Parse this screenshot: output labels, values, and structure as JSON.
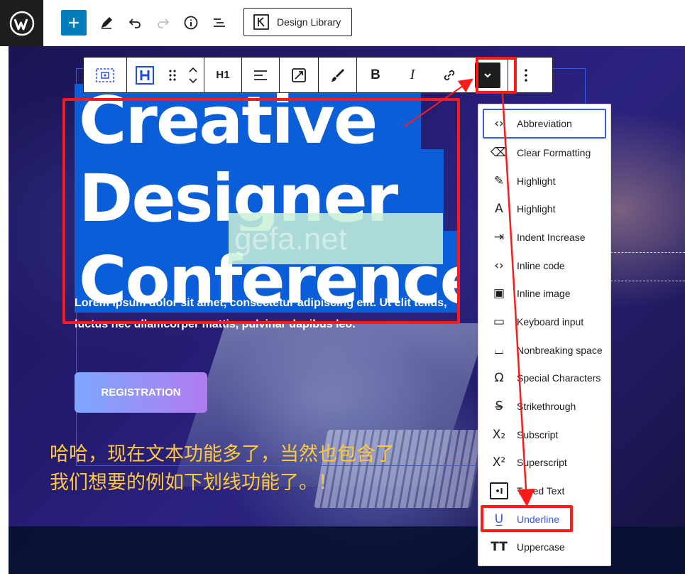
{
  "topbar": {
    "design_library_label": "Design Library"
  },
  "icons": {
    "wordpress": "wordpress-logo",
    "add": "plus-icon",
    "edit": "pencil-icon",
    "undo": "undo-icon",
    "redo": "redo-icon",
    "info": "info-icon",
    "outline": "list-view-icon"
  },
  "colors": {
    "accent": "#007cba",
    "focus": "#3858e9",
    "annotation_red": "#ff1a1a",
    "annotation_text": "#ffc83a",
    "selection": "#0a5fd9"
  },
  "block_toolbar": {
    "heading_level": "H1",
    "bold": "B",
    "italic": "I"
  },
  "hero": {
    "headline_lines": [
      "Creative",
      "Designer",
      "Conference"
    ],
    "body": "Lorem ipsum dolor sit amet, consectetur adipiscing elit. Ut elit tellus, luctus nec ullamcorper mattis, pulvinar dapibus leo.",
    "button": "REGISTRATION",
    "watermark": "gefa.net"
  },
  "dropdown": {
    "items": [
      {
        "icon": "‹›",
        "label": "Abbreviation"
      },
      {
        "icon": "⌫",
        "label": "Clear Formatting"
      },
      {
        "icon": "✎",
        "label": "Highlight"
      },
      {
        "icon": "A",
        "label": "Highlight"
      },
      {
        "icon": "⇥",
        "label": "Indent Increase"
      },
      {
        "icon": "‹›",
        "label": "Inline code"
      },
      {
        "icon": "▣",
        "label": "Inline image"
      },
      {
        "icon": "▭",
        "label": "Keyboard input"
      },
      {
        "icon": "⌴",
        "label": "Nonbreaking space"
      },
      {
        "icon": "Ω",
        "label": "Special Characters"
      },
      {
        "icon": "S̶",
        "label": "Strikethrough"
      },
      {
        "icon": "X₂",
        "label": "Subscript"
      },
      {
        "icon": "X²",
        "label": "Superscript"
      },
      {
        "icon": "•I",
        "label": "Typed Text"
      },
      {
        "icon": "U̲",
        "label": "Underline"
      },
      {
        "icon": "TT",
        "label": "Uppercase"
      }
    ]
  },
  "annotation": {
    "line1": "哈哈，现在文本功能多了，当然也包含了",
    "line2": "我们想要的例如下划线功能了。！"
  }
}
